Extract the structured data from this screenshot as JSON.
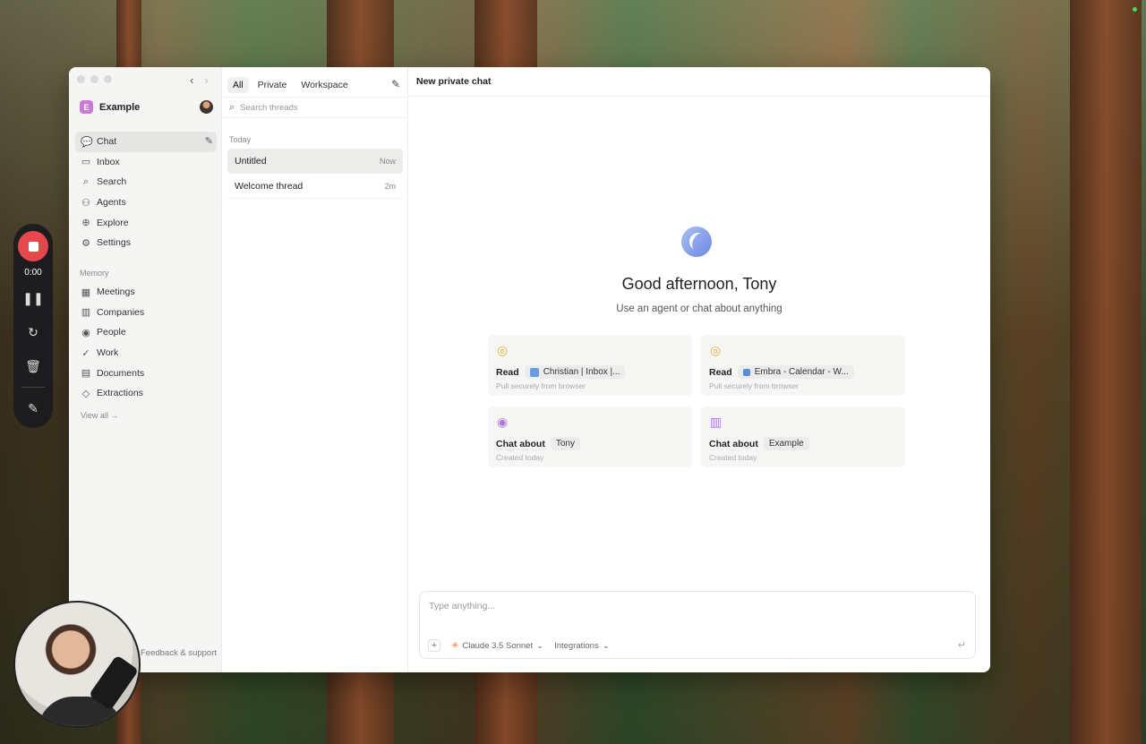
{
  "recorder": {
    "time": "0:00"
  },
  "sidebar": {
    "workspace_badge": "E",
    "workspace_name": "Example",
    "nav": [
      {
        "label": "Chat"
      },
      {
        "label": "Inbox"
      },
      {
        "label": "Search"
      },
      {
        "label": "Agents"
      },
      {
        "label": "Explore"
      },
      {
        "label": "Settings"
      }
    ],
    "memory_label": "Memory",
    "memory": [
      {
        "label": "Meetings"
      },
      {
        "label": "Companies"
      },
      {
        "label": "People"
      },
      {
        "label": "Work"
      },
      {
        "label": "Documents"
      },
      {
        "label": "Extractions"
      }
    ],
    "view_all": "View all →",
    "feedback": "Feedback & support"
  },
  "threads": {
    "tabs": [
      "All",
      "Private",
      "Workspace"
    ],
    "search_placeholder": "Search threads",
    "section_label": "Today",
    "items": [
      {
        "title": "Untitled",
        "time": "Now"
      },
      {
        "title": "Welcome thread",
        "time": "2m"
      }
    ]
  },
  "main": {
    "header": "New private chat",
    "greeting": "Good afternoon, Tony",
    "subtitle": "Use an agent or chat about anything",
    "cards": [
      {
        "action": "Read",
        "chip": "Christian | Inbox |...",
        "sub": "Pull securely from browser",
        "icon": "chrome-icon"
      },
      {
        "action": "Read",
        "chip": "Embra - Calendar - W...",
        "sub": "Pull securely from browser",
        "icon": "chrome-icon"
      },
      {
        "action": "Chat about",
        "chip": "Tony",
        "sub": "Created today",
        "icon": "person-icon"
      },
      {
        "action": "Chat about",
        "chip": "Example",
        "sub": "Created today",
        "icon": "building-icon"
      }
    ],
    "composer_placeholder": "Type anything...",
    "model": "Claude 3.5 Sonnet",
    "integrations": "Integrations"
  }
}
